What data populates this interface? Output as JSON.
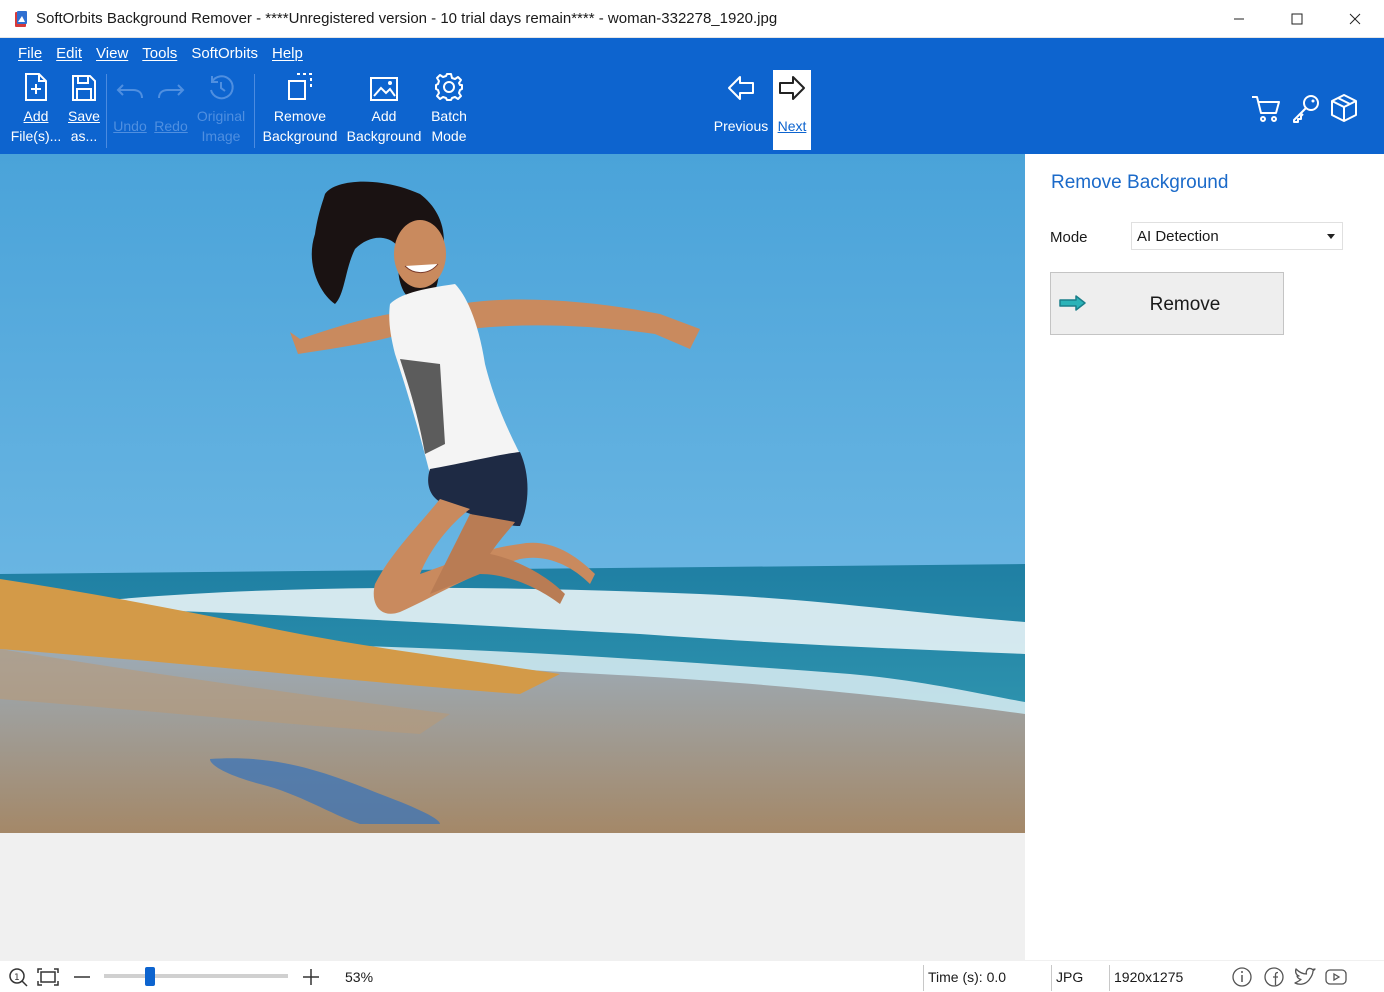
{
  "window": {
    "title": "SoftOrbits Background Remover - ****Unregistered version - 10 trial days remain**** - woman-332278_1920.jpg"
  },
  "menu": [
    "File",
    "Edit",
    "View",
    "Tools",
    "SoftOrbits",
    "Help"
  ],
  "toolbar": {
    "add_files": [
      "Add",
      "File(s)..."
    ],
    "save_as": [
      "Save",
      "as..."
    ],
    "undo": "Undo",
    "redo": "Redo",
    "original_image": [
      "Original",
      "Image"
    ],
    "remove_background": [
      "Remove",
      "Background"
    ],
    "add_background": [
      "Add",
      "Background"
    ],
    "batch_mode": [
      "Batch",
      "Mode"
    ],
    "previous": "Previous",
    "next": "Next"
  },
  "panel": {
    "title": "Remove Background",
    "mode_label": "Mode",
    "mode_value": "AI Detection",
    "remove_button": "Remove"
  },
  "status": {
    "zoom_percent": "53%",
    "zoom_slider_fraction": 0.25,
    "time": "Time (s): 0.0",
    "format": "JPG",
    "dimensions": "1920x1275"
  },
  "colors": {
    "accent": "#0d64cf",
    "panel_title": "#1b6ac9",
    "disabled_icon": "#4f8fe0"
  },
  "icons": {
    "status_right": [
      "info-icon",
      "facebook-icon",
      "twitter-icon",
      "youtube-icon"
    ],
    "toolbar_right": [
      "cart-icon",
      "key-icon",
      "box-icon"
    ]
  }
}
